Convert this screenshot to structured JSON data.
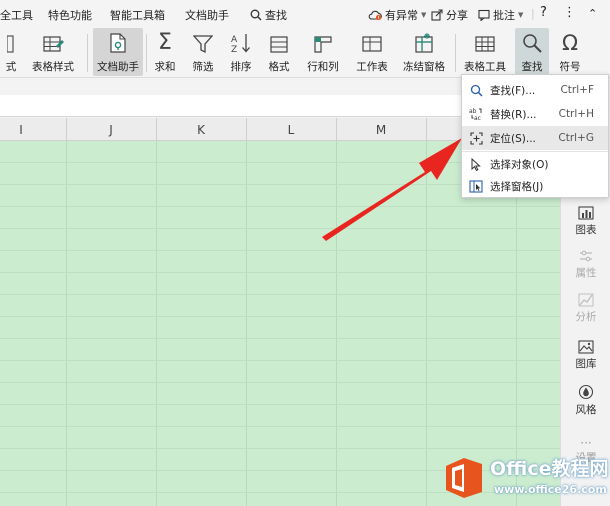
{
  "menubar": {
    "items": [
      "全工具",
      "特色功能",
      "智能工具箱",
      "文档助手"
    ],
    "search_label": "查找",
    "status_label": "有异常",
    "share_label": "分享",
    "review_label": "批注",
    "help_label": "?",
    "more_label": "⋮"
  },
  "ribbon": {
    "buttons": [
      "式",
      "表格样式",
      "文档助手",
      "求和",
      "筛选",
      "排序",
      "格式",
      "行和列",
      "工作表",
      "冻结窗格",
      "表格工具",
      "查找",
      "符号"
    ]
  },
  "sheet": {
    "columns": [
      "I",
      "J",
      "K",
      "L",
      "M"
    ]
  },
  "sidepanel": {
    "items": [
      "图表",
      "属性",
      "分析",
      "图库",
      "风格",
      "设置"
    ]
  },
  "dropdown": {
    "items": [
      {
        "label": "查找(F)...",
        "shortcut": "Ctrl+F"
      },
      {
        "label": "替换(R)...",
        "shortcut": "Ctrl+H"
      },
      {
        "label": "定位(S)...",
        "shortcut": "Ctrl+G"
      },
      {
        "label": "选择对象(O)",
        "shortcut": ""
      },
      {
        "label": "选择窗格(J)",
        "shortcut": ""
      }
    ]
  },
  "watermark": {
    "title": "Office教程网",
    "url": "www.office26.com"
  },
  "colors": {
    "grid_bg": "#cbeccf",
    "grid_line": "#b9d9bd",
    "arrow": "#e8261f",
    "logo_orange": "#e8541e",
    "icon_teal": "#2c8a7a"
  }
}
